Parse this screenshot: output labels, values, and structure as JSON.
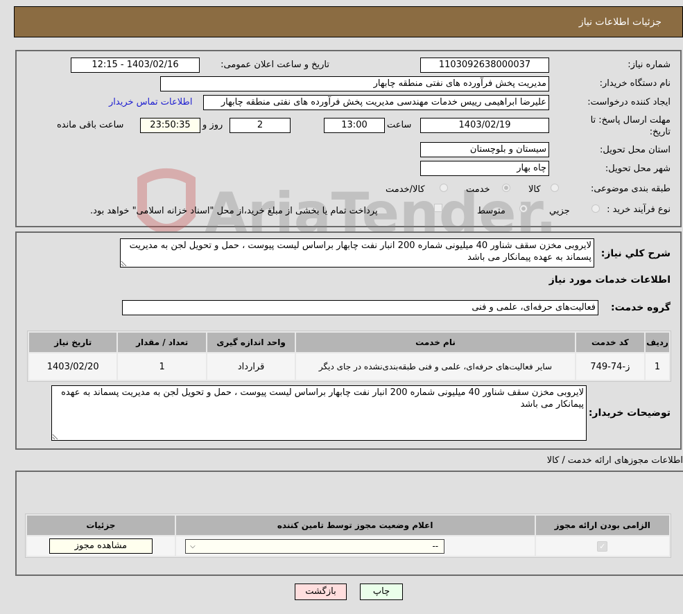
{
  "header": {
    "title": "جزئیات اطلاعات نیاز"
  },
  "form": {
    "need_number": {
      "label": "شماره نیاز:",
      "value": "1103092638000037"
    },
    "announce_datetime": {
      "label": "تاریخ و ساعت اعلان عمومی:",
      "value": "1403/02/16 - 12:15"
    },
    "buyer_org": {
      "label": "نام دستگاه خریدار:",
      "value": "مدیریت پخش فرآورده های نفتی منطقه چابهار"
    },
    "requester": {
      "label": "ایجاد کننده درخواست:",
      "value": "علیرضا ابراهیمی رییس خدمات مهندسی مدیریت پخش فرآورده های نفتی منطقه چابهار",
      "contact_link": "اطلاعات تماس خریدار"
    },
    "deadline": {
      "label": "مهلت ارسال پاسخ: تا تاریخ:",
      "date": "1403/02/19",
      "time_label": "ساعت",
      "time": "13:00",
      "days": "2",
      "days_label": "روز و",
      "remaining": "23:50:35",
      "remaining_label": "ساعت باقی مانده"
    },
    "province": {
      "label": "استان محل تحویل:",
      "value": "سیستان و بلوچستان"
    },
    "city": {
      "label": "شهر محل تحویل:",
      "value": "چاه بهار"
    },
    "category": {
      "label": "طبقه بندی موضوعی:",
      "options": [
        "کالا",
        "خدمت",
        "کالا/خدمت"
      ],
      "selected": "خدمت"
    },
    "purchase_type": {
      "label": "نوع فرآیند خرید :",
      "options": [
        "جزیي",
        "متوسط"
      ],
      "selected": "متوسط",
      "treasury_note": "پرداخت تمام یا بخشی از مبلغ خرید،از محل \"اسناد خزانه اسلامی\" خواهد بود."
    }
  },
  "description": {
    "label": "شرح کلي نیاز:",
    "value": "لایروبی مخزن سقف شناور 40 میلیونی شماره 200 انبار نفت چابهار براساس لیست پیوست ، حمل و تحویل لجن به مدیریت پسماند به عهده پیمانکار می باشد"
  },
  "services": {
    "section_title": "اطلاعات خدمات مورد نیاز",
    "group_label": "گروه خدمت:",
    "group_value": "فعالیت‌های حرفه‌ای، علمی و فنی",
    "columns": [
      "ردیف",
      "کد خدمت",
      "نام خدمت",
      "واحد اندازه گیری",
      "تعداد / مقدار",
      "تاریخ نیاز"
    ],
    "rows": [
      {
        "index": "1",
        "code": "ز-74-749",
        "name": "سایر فعالیت‌های حرفه‌ای، علمی و فنی طبقه‌بندی‌نشده در جای دیگر",
        "unit": "قرارداد",
        "qty": "1",
        "date": "1403/02/20"
      }
    ]
  },
  "buyer_notes": {
    "label": "توضیحات خریدار:",
    "value": "لایروبی مخزن سقف شناور 40 میلیونی شماره 200 انبار نفت چابهار براساس لیست پیوست ، حمل و تحویل لجن به مدیریت پسماند به عهده پیمانکار می باشد"
  },
  "permits": {
    "section_title": "اطلاعات مجوزهای ارائه خدمت / کالا",
    "columns": [
      "الزامی بودن ارائه مجوز",
      "اعلام وضعیت مجوز توسط تامین کننده",
      "جزئیات"
    ],
    "rows": [
      {
        "required": true,
        "status": "--",
        "details_button": "مشاهده مجوز"
      }
    ]
  },
  "buttons": {
    "print": "چاپ",
    "back": "بازگشت"
  },
  "watermark": {
    "text": "AriaTender.neT"
  },
  "colors": {
    "header_bg": "#8b6c42",
    "print_bg": "#eaffea",
    "back_bg": "#ffdede",
    "link": "#2020d0"
  }
}
